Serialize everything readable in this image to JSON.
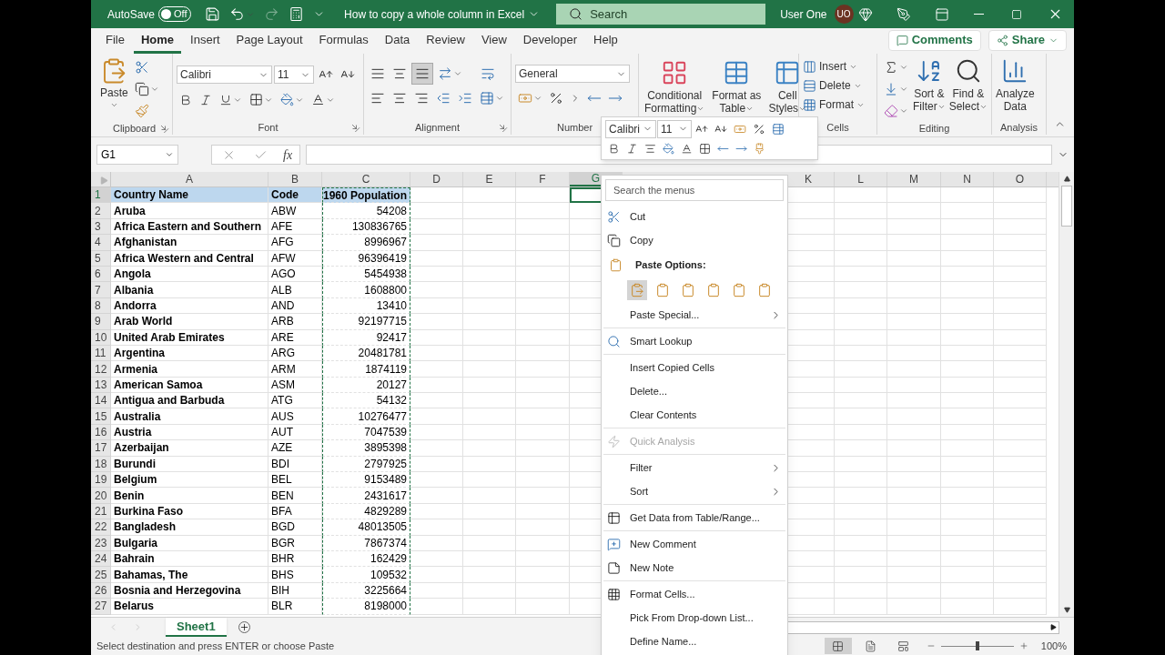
{
  "title_bar": {
    "autosave_label": "AutoSave",
    "autosave": {
      "on": false,
      "label": "Off"
    },
    "redo": {
      "disabled": true
    },
    "document_title": "How to copy a whole column in Excel",
    "search": {
      "placeholder": "Search"
    },
    "user_name": "User One",
    "avatar_initials": "UO"
  },
  "ribbon_tabs": [
    {
      "label": "File",
      "selected": false
    },
    {
      "label": "Home",
      "selected": true
    },
    {
      "label": "Insert",
      "selected": false
    },
    {
      "label": "Page Layout",
      "selected": false
    },
    {
      "label": "Formulas",
      "selected": false
    },
    {
      "label": "Data",
      "selected": false
    },
    {
      "label": "Review",
      "selected": false
    },
    {
      "label": "View",
      "selected": false
    },
    {
      "label": "Developer",
      "selected": false
    },
    {
      "label": "Help",
      "selected": false
    }
  ],
  "comments_button": "Comments",
  "share_button": "Share",
  "ribbon": {
    "clipboard": {
      "paste": "Paste",
      "label": "Clipboard"
    },
    "font": {
      "name": "Calibri",
      "size": "11",
      "label": "Font"
    },
    "alignment": {
      "label": "Alignment"
    },
    "number": {
      "format": "General",
      "label": "Number"
    },
    "styles": [
      {
        "lines": [
          "Conditional",
          "Formatting"
        ]
      },
      {
        "lines": [
          "Format as",
          "Table"
        ]
      },
      {
        "lines": [
          "Cell",
          "Styles"
        ]
      }
    ],
    "cells": {
      "buttons": [
        "Insert",
        "Delete",
        "Format"
      ],
      "label": "Cells"
    },
    "editing": {
      "sort": [
        "Sort &",
        "Filter"
      ],
      "find": [
        "Find &",
        "Select"
      ],
      "label": "Editing"
    },
    "analysis": {
      "button": [
        "Analyze",
        "Data"
      ],
      "label": "Analysis"
    }
  },
  "formula_bar": {
    "name_box": "G1",
    "fx": "fx"
  },
  "columns": [
    {
      "label": "A",
      "selected": false,
      "bold": true,
      "right_aligned": false,
      "copied": false
    },
    {
      "label": "B",
      "selected": false,
      "bold": false,
      "right_aligned": false,
      "copied": false
    },
    {
      "label": "C",
      "selected": false,
      "bold": false,
      "right_aligned": true,
      "copied": true
    },
    {
      "label": "D",
      "selected": false
    },
    {
      "label": "E",
      "selected": false
    },
    {
      "label": "F",
      "selected": false
    },
    {
      "label": "G",
      "selected": true
    },
    {
      "label": "K",
      "selected": false
    },
    {
      "label": "L",
      "selected": false
    },
    {
      "label": "M",
      "selected": false
    },
    {
      "label": "N",
      "selected": false
    },
    {
      "label": "O",
      "selected": false
    }
  ],
  "rows": [
    {
      "number": "1",
      "selected": true,
      "kind": "header",
      "cells": [
        "Country Name",
        "Code",
        "1960 Population"
      ]
    },
    {
      "number": "2",
      "selected": false,
      "kind": "data",
      "cells": [
        "Aruba",
        "ABW",
        "54208"
      ]
    },
    {
      "number": "3",
      "selected": false,
      "kind": "data",
      "cells": [
        "Africa Eastern and Southern",
        "AFE",
        "130836765"
      ]
    },
    {
      "number": "4",
      "selected": false,
      "kind": "data",
      "cells": [
        "Afghanistan",
        "AFG",
        "8996967"
      ]
    },
    {
      "number": "5",
      "selected": false,
      "kind": "data",
      "cells": [
        "Africa Western and Central",
        "AFW",
        "96396419"
      ]
    },
    {
      "number": "6",
      "selected": false,
      "kind": "data",
      "cells": [
        "Angola",
        "AGO",
        "5454938"
      ]
    },
    {
      "number": "7",
      "selected": false,
      "kind": "data",
      "cells": [
        "Albania",
        "ALB",
        "1608800"
      ]
    },
    {
      "number": "8",
      "selected": false,
      "kind": "data",
      "cells": [
        "Andorra",
        "AND",
        "13410"
      ]
    },
    {
      "number": "9",
      "selected": false,
      "kind": "data",
      "cells": [
        "Arab World",
        "ARB",
        "92197715"
      ]
    },
    {
      "number": "10",
      "selected": false,
      "kind": "data",
      "cells": [
        "United Arab Emirates",
        "ARE",
        "92417"
      ]
    },
    {
      "number": "11",
      "selected": false,
      "kind": "data",
      "cells": [
        "Argentina",
        "ARG",
        "20481781"
      ]
    },
    {
      "number": "12",
      "selected": false,
      "kind": "data",
      "cells": [
        "Armenia",
        "ARM",
        "1874119"
      ]
    },
    {
      "number": "13",
      "selected": false,
      "kind": "data",
      "cells": [
        "American Samoa",
        "ASM",
        "20127"
      ]
    },
    {
      "number": "14",
      "selected": false,
      "kind": "data",
      "cells": [
        "Antigua and Barbuda",
        "ATG",
        "54132"
      ]
    },
    {
      "number": "15",
      "selected": false,
      "kind": "data",
      "cells": [
        "Australia",
        "AUS",
        "10276477"
      ]
    },
    {
      "number": "16",
      "selected": false,
      "kind": "data",
      "cells": [
        "Austria",
        "AUT",
        "7047539"
      ]
    },
    {
      "number": "17",
      "selected": false,
      "kind": "data",
      "cells": [
        "Azerbaijan",
        "AZE",
        "3895398"
      ]
    },
    {
      "number": "18",
      "selected": false,
      "kind": "data",
      "cells": [
        "Burundi",
        "BDI",
        "2797925"
      ]
    },
    {
      "number": "19",
      "selected": false,
      "kind": "data",
      "cells": [
        "Belgium",
        "BEL",
        "9153489"
      ]
    },
    {
      "number": "20",
      "selected": false,
      "kind": "data",
      "cells": [
        "Benin",
        "BEN",
        "2431617"
      ]
    },
    {
      "number": "21",
      "selected": false,
      "kind": "data",
      "cells": [
        "Burkina Faso",
        "BFA",
        "4829289"
      ]
    },
    {
      "number": "22",
      "selected": false,
      "kind": "data",
      "cells": [
        "Bangladesh",
        "BGD",
        "48013505"
      ]
    },
    {
      "number": "23",
      "selected": false,
      "kind": "data",
      "cells": [
        "Bulgaria",
        "BGR",
        "7867374"
      ]
    },
    {
      "number": "24",
      "selected": false,
      "kind": "data",
      "cells": [
        "Bahrain",
        "BHR",
        "162429"
      ]
    },
    {
      "number": "25",
      "selected": false,
      "kind": "data",
      "cells": [
        "Bahamas, The",
        "BHS",
        "109532"
      ]
    },
    {
      "number": "26",
      "selected": false,
      "kind": "data",
      "cells": [
        "Bosnia and Herzegovina",
        "BIH",
        "3225664"
      ]
    },
    {
      "number": "27",
      "selected": false,
      "kind": "data",
      "cells": [
        "Belarus",
        "BLR",
        "8198000"
      ]
    }
  ],
  "mini_toolbar": {
    "font": "Calibri",
    "size": "11"
  },
  "context_menu": {
    "search_placeholder": "Search the menus",
    "items": [
      {
        "kind": "item",
        "label": "Cut",
        "submenu": false,
        "disabled": false
      },
      {
        "kind": "item",
        "label": "Copy",
        "submenu": false,
        "disabled": false
      },
      {
        "kind": "heading",
        "label": "Paste Options:"
      },
      {
        "kind": "paste_icons",
        "options": [
          {
            "selected": true
          },
          {
            "selected": false
          },
          {
            "selected": false
          },
          {
            "selected": false
          },
          {
            "selected": false
          },
          {
            "selected": false
          }
        ]
      },
      {
        "kind": "item",
        "label": "Paste Special...",
        "submenu": true,
        "disabled": false
      },
      {
        "kind": "separator"
      },
      {
        "kind": "item",
        "label": "Smart Lookup",
        "submenu": false,
        "disabled": false
      },
      {
        "kind": "separator"
      },
      {
        "kind": "item",
        "label": "Insert Copied Cells",
        "submenu": false,
        "disabled": false
      },
      {
        "kind": "item",
        "label": "Delete...",
        "submenu": false,
        "disabled": false
      },
      {
        "kind": "item",
        "label": "Clear Contents",
        "submenu": false,
        "disabled": false
      },
      {
        "kind": "separator"
      },
      {
        "kind": "item",
        "label": "Quick Analysis",
        "submenu": false,
        "disabled": true
      },
      {
        "kind": "separator"
      },
      {
        "kind": "item",
        "label": "Filter",
        "submenu": true,
        "disabled": false
      },
      {
        "kind": "item",
        "label": "Sort",
        "submenu": true,
        "disabled": false
      },
      {
        "kind": "separator"
      },
      {
        "kind": "item",
        "label": "Get Data from Table/Range...",
        "submenu": false,
        "disabled": false
      },
      {
        "kind": "separator"
      },
      {
        "kind": "item",
        "label": "New Comment",
        "submenu": false,
        "disabled": false
      },
      {
        "kind": "item",
        "label": "New Note",
        "submenu": false,
        "disabled": false
      },
      {
        "kind": "separator"
      },
      {
        "kind": "item",
        "label": "Format Cells...",
        "submenu": false,
        "disabled": false
      },
      {
        "kind": "item",
        "label": "Pick From Drop-down List...",
        "submenu": false,
        "disabled": false
      },
      {
        "kind": "item",
        "label": "Define Name...",
        "submenu": false,
        "disabled": false
      }
    ]
  },
  "sheet_tabs": [
    {
      "label": "Sheet1",
      "selected": true
    }
  ],
  "status_bar": {
    "message": "Select destination and press ENTER or choose Paste",
    "views": [
      {
        "selected": true
      },
      {
        "selected": false
      },
      {
        "selected": false
      }
    ],
    "zoom": {
      "level": 0.5,
      "reading": "100%"
    }
  }
}
